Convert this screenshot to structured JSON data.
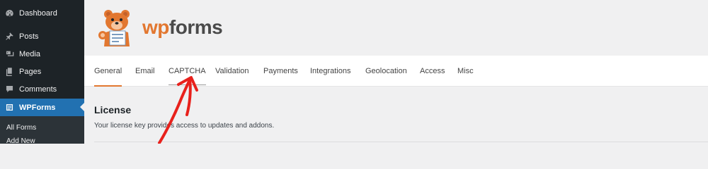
{
  "sidebar": {
    "items": [
      {
        "label": "Dashboard",
        "icon": "dashboard-icon"
      },
      {
        "label": "Posts",
        "icon": "pin-icon"
      },
      {
        "label": "Media",
        "icon": "media-icon"
      },
      {
        "label": "Pages",
        "icon": "pages-icon"
      },
      {
        "label": "Comments",
        "icon": "comments-icon"
      },
      {
        "label": "WPForms",
        "icon": "wpforms-icon",
        "active": true
      }
    ],
    "submenu": [
      "All Forms",
      "Add New"
    ]
  },
  "header": {
    "logo_wp": "wp",
    "logo_forms": "forms",
    "brand_color": "#e27730"
  },
  "tabs": [
    "General",
    "Email",
    "CAPTCHA",
    "Validation",
    "Payments",
    "Integrations",
    "Geolocation",
    "Access",
    "Misc"
  ],
  "active_tab": "General",
  "section": {
    "title": "License",
    "description": "Your license key provides access to updates and addons."
  },
  "annotation": {
    "type": "red-arrow",
    "color": "#e8211c",
    "points_to": "CAPTCHA"
  }
}
